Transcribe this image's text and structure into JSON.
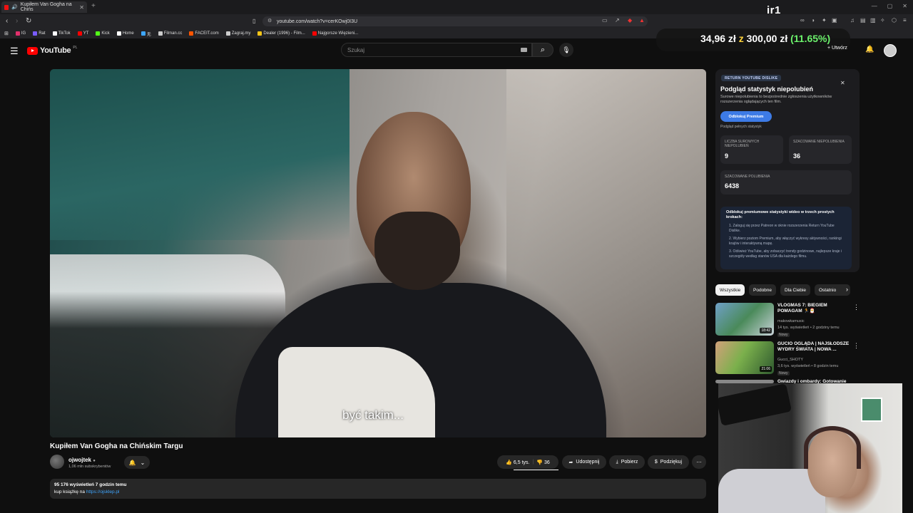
{
  "browser": {
    "tab_title": "Kupiłem Van Gogha na Chińs",
    "url": "youtube.com/watch?v=cerKOwj0I3U",
    "bookmarks": [
      {
        "label": "IG",
        "color": "#e1306c"
      },
      {
        "label": "Rat",
        "color": "#7a5cff"
      },
      {
        "label": "TikTok",
        "color": "#ffffff"
      },
      {
        "label": "YT",
        "color": "#ff0000"
      },
      {
        "label": "Kick",
        "color": "#53fc18"
      },
      {
        "label": "Home",
        "color": "#ffffff"
      },
      {
        "label": "无",
        "color": "#3ea6ff"
      },
      {
        "label": "Filman.cc",
        "color": "#cccccc"
      },
      {
        "label": "FACEIT.com",
        "color": "#ff5500"
      },
      {
        "label": "Zagraj.my",
        "color": "#cccccc"
      },
      {
        "label": "Dealer (1996) - Film...",
        "color": "#f5c518"
      },
      {
        "label": "Najgorsze Więzieni...",
        "color": "#ff0000"
      }
    ]
  },
  "overlay": {
    "brand": "ir1",
    "donation_current": "34,96 zł",
    "donation_sep": "z",
    "donation_goal": "300,00 zł",
    "donation_pct": "(11.65%)"
  },
  "header": {
    "logo_text": "YouTube",
    "logo_country": "PL",
    "search_placeholder": "Szukaj",
    "create_label": "Utwórz"
  },
  "video": {
    "subtitle": "być takim...",
    "title": "Kupiłem Van Gogha na Chińskim Targu",
    "channel": "ojwojtek",
    "subscribers": "1,06 mln subskrybentów",
    "likes": "6,5 tys.",
    "dislikes": "36",
    "share_label": "Udostępnij",
    "download_label": "Pobierz",
    "thanks_label": "Podziękuj",
    "views_line": "95 176 wyświetleń  7 godzin temu",
    "desc_prefix": "kup książkę na ",
    "desc_link": "https://ojsklep.pl"
  },
  "ryd": {
    "badge": "RETURN YOUTUBE DISLIKE",
    "title": "Podgląd statystyk niepolubień",
    "description": "Surowe niepolubienia to bezpośrednie zgłoszenia użytkowników rozszerzenia oglądających ten film.",
    "premium_button": "Odblokuj Premium",
    "full_stats_link": "Podgląd pełnych statystyk",
    "stats": [
      {
        "label": "LICZBA SUROWYCH NIEPOLUBIEŃ",
        "value": "9"
      },
      {
        "label": "SZACOWANE NIEPOLUBIENIA",
        "value": "36"
      },
      {
        "label": "SZACOWANE POLUBIENIA",
        "value": "6438"
      }
    ],
    "info_title": "Odblokuj premiumowe statystyki wideo w trzech prostych krokach:",
    "info_steps": [
      "1. Zaloguj się przez Patreon w oknie rozszerzenia Return YouTube Dislike.",
      "2. Wybierz poziom Premium, aby włączyć wykresy aktywności, rankingi krajów i interaktywną mapę.",
      "3. Odśwież YouTube, aby zobaczyć trendy godzinowe, najlepsze kraje i szczegóły według stanów USA dla każdego filmu."
    ]
  },
  "chips": [
    "Wszystkie",
    "Podobne",
    "Dla Ciebie",
    "Ostatnio"
  ],
  "recommended": [
    {
      "title": "VLOGMAS 7: BIEGIEM POMAGAM 🏃🎅",
      "channel": "makowkamusic",
      "meta": "14 tys. wyświetleń • 2 godziny temu",
      "badge": "Nowy",
      "duration": "18:42"
    },
    {
      "title": "GUCIO OGLĄDA | NAJSŁODSZE WYDRY ŚWIATA | NOWA ...",
      "channel": "Gucci_SHOTY",
      "meta": "3,6 tys. wyświetleń • 8 godzin temu",
      "badge": "Nowy",
      "duration": "21:06"
    },
    {
      "title": "Gwiazdy i ombardy: Gotowanie",
      "channel": "",
      "meta": "",
      "badge": "",
      "duration": ""
    }
  ]
}
